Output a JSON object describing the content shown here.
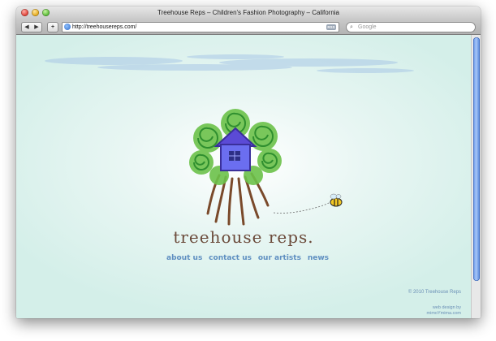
{
  "window": {
    "title": "Treehouse Reps – Children's Fashion Photography – California"
  },
  "toolbar": {
    "back_label": "◀",
    "forward_label": "▶",
    "add_label": "+",
    "url": "http://treehousereps.com/",
    "rss_label": "RSS",
    "search_placeholder": "Google"
  },
  "page": {
    "logo_text": "treehouse reps.",
    "nav": [
      {
        "label": "about us"
      },
      {
        "label": "contact us"
      },
      {
        "label": "our artists"
      },
      {
        "label": "news"
      }
    ],
    "copyright": "© 2010 Treehouse Reps",
    "credit_line1": "web design by",
    "credit_line2": "mimoYmima.com"
  },
  "colors": {
    "nav_link": "#5f8fc1",
    "wordmark": "#6b4a3a",
    "background": "#d4efe9"
  }
}
